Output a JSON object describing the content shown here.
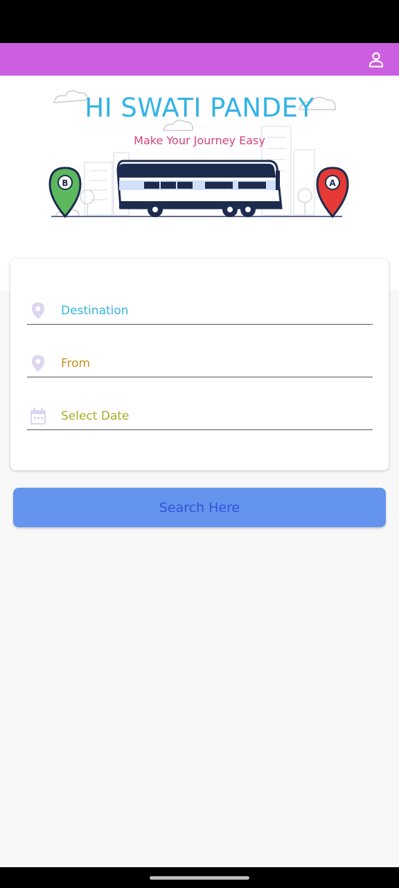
{
  "header": {
    "profile_icon": "person-outline-icon",
    "bar_color": "#cb5fe0"
  },
  "banner": {
    "title": "HI SWATI PANDEY",
    "subtitle": "Make Your Journey Easy",
    "marker_left": "B",
    "marker_right": "A"
  },
  "form": {
    "destination": {
      "label": "Destination",
      "icon": "location-pin-icon"
    },
    "from": {
      "label": "From",
      "icon": "location-pin-icon"
    },
    "date": {
      "label": "Select Date",
      "icon": "calendar-icon"
    }
  },
  "search_button": {
    "label": "Search Here",
    "color": "#6594ee"
  }
}
